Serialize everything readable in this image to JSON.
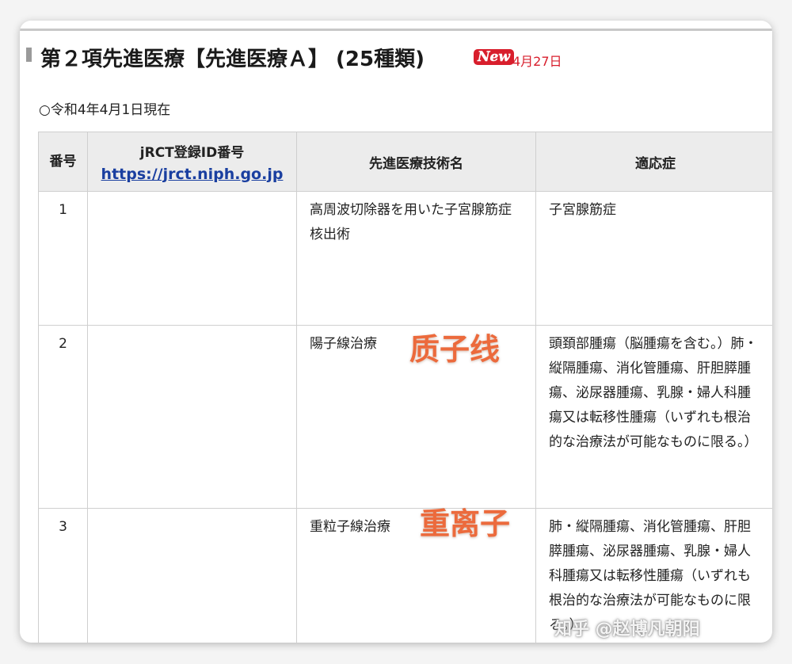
{
  "header": {
    "title": "第２項先進医療【先進医療Ａ】 (25種類)",
    "new_badge": "New",
    "new_date": "4月27日"
  },
  "as_of": "○令和4年4月1日現在",
  "table": {
    "columns": [
      "番号",
      "jRCT登録ID番号",
      "先進医療技術名",
      "適応症"
    ],
    "jrct_link": "https://jrct.niph.go.jp",
    "rows": [
      {
        "num": "1",
        "id": "",
        "name": "高周波切除器を用いた子宮腺筋症核出術",
        "indication": "子宮腺筋症"
      },
      {
        "num": "2",
        "id": "",
        "name": "陽子線治療",
        "indication": "頭頚部腫瘍（脳腫瘍を含む。）肺・縦隔腫瘍、消化管腫瘍、肝胆膵腫瘍、泌尿器腫瘍、乳腺・婦人科腫瘍又は転移性腫瘍（いずれも根治的な治療法が可能なものに限る。）"
      },
      {
        "num": "3",
        "id": "",
        "name": "重粒子線治療",
        "indication": "肺・縦隔腫瘍、消化管腫瘍、肝胆膵腫瘍、泌尿器腫瘍、乳腺・婦人科腫瘍又は転移性腫瘍（いずれも根治的な治療法が可能なものに限る。）"
      }
    ]
  },
  "annotations": {
    "proton": "质子线",
    "heavy_ion": "重离子"
  },
  "watermark": "知乎 @赵博凡朝阳"
}
